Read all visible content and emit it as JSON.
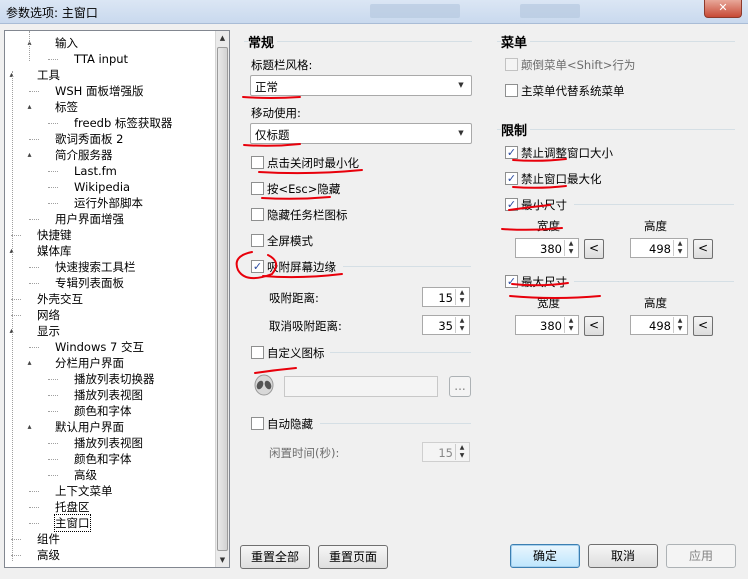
{
  "window": {
    "title": "参数选项: 主窗口",
    "close_label": "✕"
  },
  "tree": {
    "items": [
      {
        "label": "输入",
        "depth": 2,
        "toggle": "▴"
      },
      {
        "label": "TTA input",
        "depth": 3,
        "toggle": ""
      },
      {
        "label": "工具",
        "depth": 1,
        "toggle": "▴"
      },
      {
        "label": "WSH 面板增强版",
        "depth": 2,
        "toggle": ""
      },
      {
        "label": "标签",
        "depth": 2,
        "toggle": "▴"
      },
      {
        "label": "freedb 标签获取器",
        "depth": 3,
        "toggle": ""
      },
      {
        "label": "歌词秀面板 2",
        "depth": 2,
        "toggle": ""
      },
      {
        "label": "简介服务器",
        "depth": 2,
        "toggle": "▴"
      },
      {
        "label": "Last.fm",
        "depth": 3,
        "toggle": ""
      },
      {
        "label": "Wikipedia",
        "depth": 3,
        "toggle": ""
      },
      {
        "label": "运行外部脚本",
        "depth": 3,
        "toggle": ""
      },
      {
        "label": "用户界面增强",
        "depth": 2,
        "toggle": ""
      },
      {
        "label": "快捷键",
        "depth": 1,
        "toggle": ""
      },
      {
        "label": "媒体库",
        "depth": 1,
        "toggle": "▴"
      },
      {
        "label": "快速搜索工具栏",
        "depth": 2,
        "toggle": ""
      },
      {
        "label": "专辑列表面板",
        "depth": 2,
        "toggle": ""
      },
      {
        "label": "外壳交互",
        "depth": 1,
        "toggle": ""
      },
      {
        "label": "网络",
        "depth": 1,
        "toggle": ""
      },
      {
        "label": "显示",
        "depth": 1,
        "toggle": "▴"
      },
      {
        "label": "Windows 7 交互",
        "depth": 2,
        "toggle": ""
      },
      {
        "label": "分栏用户界面",
        "depth": 2,
        "toggle": "▴"
      },
      {
        "label": "播放列表切换器",
        "depth": 3,
        "toggle": ""
      },
      {
        "label": "播放列表视图",
        "depth": 3,
        "toggle": ""
      },
      {
        "label": "颜色和字体",
        "depth": 3,
        "toggle": ""
      },
      {
        "label": "默认用户界面",
        "depth": 2,
        "toggle": "▴"
      },
      {
        "label": "播放列表视图",
        "depth": 3,
        "toggle": ""
      },
      {
        "label": "颜色和字体",
        "depth": 3,
        "toggle": ""
      },
      {
        "label": "高级",
        "depth": 3,
        "toggle": ""
      },
      {
        "label": "上下文菜单",
        "depth": 2,
        "toggle": ""
      },
      {
        "label": "托盘区",
        "depth": 2,
        "toggle": ""
      },
      {
        "label": "主窗口",
        "depth": 2,
        "toggle": "",
        "selected": true
      },
      {
        "label": "组件",
        "depth": 1,
        "toggle": ""
      },
      {
        "label": "高级",
        "depth": 1,
        "toggle": ""
      }
    ]
  },
  "general": {
    "group_title": "常规",
    "titlebar_style_label": "标题栏风格:",
    "titlebar_style_value": "正常",
    "move_use_label": "移动使用:",
    "move_use_value": "仅标题",
    "minimize_on_close_label": "点击关闭时最小化",
    "esc_hide_label": "按<Esc>隐藏",
    "hide_taskbar_icon_label": "隐藏任务栏图标",
    "fullscreen_label": "全屏模式",
    "snap_edges_label": "吸附屏幕边缘",
    "snap_distance_label": "吸附距离:",
    "snap_distance_value": "15",
    "unsnap_distance_label": "取消吸附距离:",
    "unsnap_distance_value": "35",
    "custom_icon_label": "自定义图标",
    "browse_label": "...",
    "auto_hide_label": "自动隐藏",
    "idle_time_label": "闲置时间(秒):",
    "idle_time_value": "15"
  },
  "menu": {
    "group_title": "菜单",
    "invert_menu_label": "颠倒菜单<Shift>行为",
    "main_menu_label": "主菜单代替系统菜单"
  },
  "limits": {
    "group_title": "限制",
    "disable_resize_label": "禁止调整窗口大小",
    "disable_maximize_label": "禁止窗口最大化",
    "min_size_label": "最小尺寸",
    "max_size_label": "最大尺寸",
    "width_label": "宽度",
    "height_label": "高度",
    "min_width": "380",
    "min_height": "498",
    "max_width": "380",
    "max_height": "498",
    "pick_label": "<"
  },
  "buttons": {
    "reset_all": "重置全部",
    "reset_page": "重置页面",
    "ok": "确定",
    "cancel": "取消",
    "apply": "应用"
  },
  "colors": {
    "annotation": "#e8000b",
    "check": "#2a4aa0"
  }
}
